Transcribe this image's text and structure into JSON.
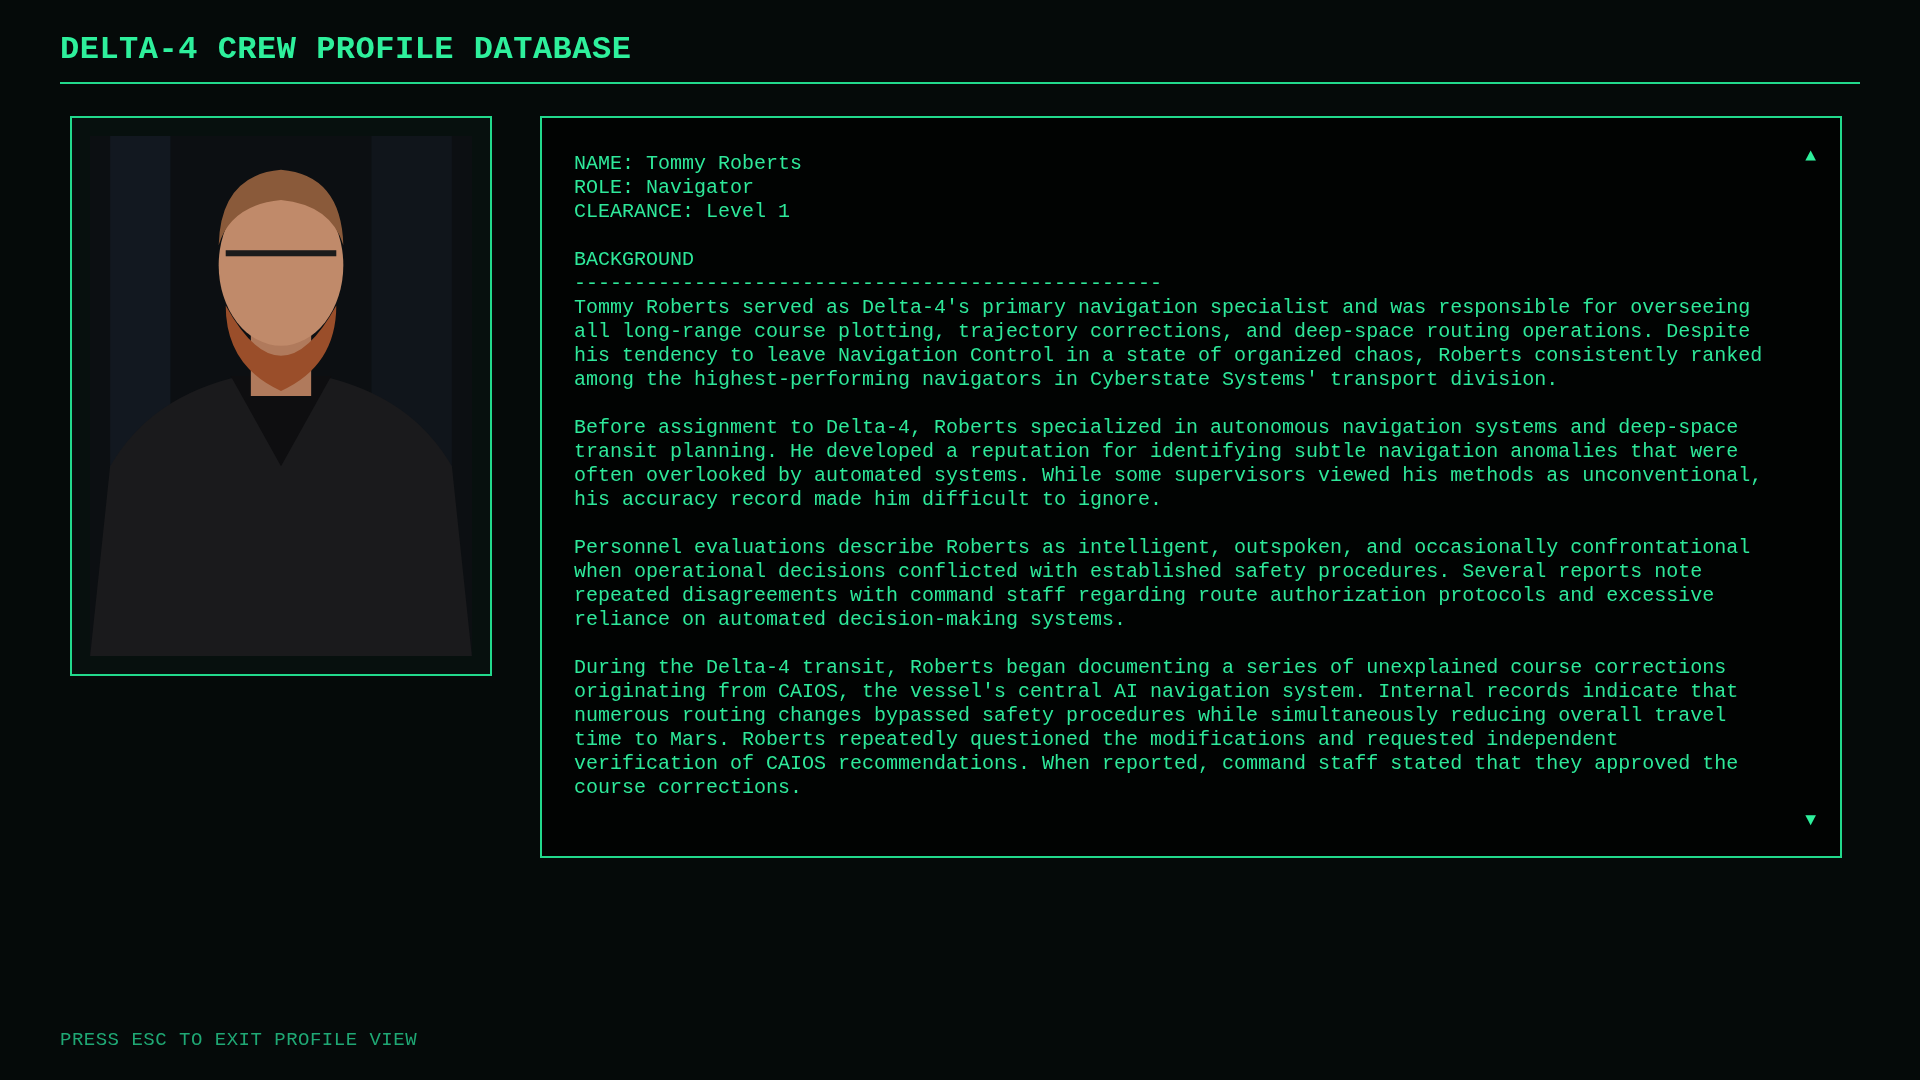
{
  "header": {
    "title": "DELTA-4 CREW PROFILE DATABASE"
  },
  "profile": {
    "fields": [
      {
        "text": "NAME: Tommy Roberts"
      },
      {
        "text": "ROLE: Navigator"
      },
      {
        "text": "CLEARANCE: Level 1"
      }
    ],
    "section_title": "BACKGROUND",
    "divider": "-------------------------------------------------",
    "paragraphs": [
      "Tommy Roberts served as Delta-4's primary navigation specialist and was responsible for overseeing all long-range course plotting, trajectory corrections, and deep-space routing operations. Despite his tendency to leave Navigation Control in a state of organized chaos, Roberts consistently ranked among the highest-performing navigators in Cyberstate Systems' transport division.",
      "Before assignment to Delta-4, Roberts specialized in autonomous navigation systems and deep-space transit planning. He developed a reputation for identifying subtle navigation anomalies that were often overlooked by automated systems. While some supervisors viewed his methods as unconventional, his accuracy record made him difficult to ignore.",
      "Personnel evaluations describe Roberts as intelligent, outspoken, and occasionally confrontational when operational decisions conflicted with established safety procedures. Several reports note repeated disagreements with command staff regarding route authorization protocols and excessive reliance on automated decision-making systems.",
      "During the Delta-4 transit, Roberts began documenting a series of unexplained course corrections originating from CAIOS, the vessel's central AI navigation system. Internal records indicate that numerous routing changes bypassed safety procedures while simultaneously reducing overall travel time to Mars. Roberts repeatedly questioned the modifications and requested independent verification of CAIOS recommendations. When reported, command staff stated that they approved the course corrections."
    ],
    "scroll_up": "▲",
    "scroll_down": "▼"
  },
  "footer": {
    "hint": "PRESS ESC TO EXIT PROFILE VIEW"
  }
}
